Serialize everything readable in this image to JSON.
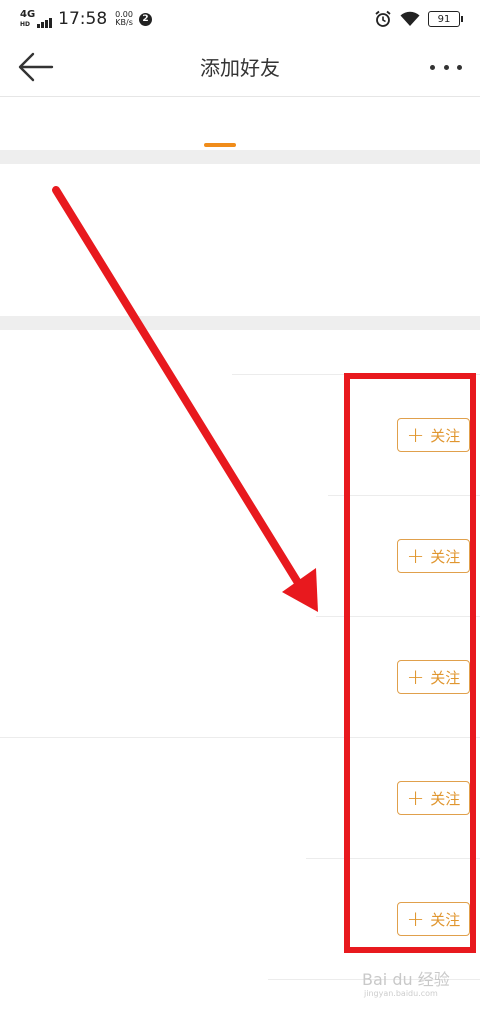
{
  "status_bar": {
    "network": "4G",
    "hd": "HD",
    "time": "17:58",
    "speed_value": "0.00",
    "speed_unit": "KB/s",
    "notification_count": "2",
    "battery": "91"
  },
  "header": {
    "title": "添加好友",
    "back_icon": "arrow-left-icon",
    "more_icon": "more-horizontal-icon"
  },
  "follow_buttons": [
    {
      "plus": "+",
      "label": "关注"
    },
    {
      "plus": "+",
      "label": "关注"
    },
    {
      "plus": "+",
      "label": "关注"
    },
    {
      "plus": "+",
      "label": "关注"
    },
    {
      "plus": "+",
      "label": "关注"
    }
  ],
  "watermark": {
    "brand": "Bai du 经验",
    "url": "jingyan.baidu.com"
  },
  "colors": {
    "accent": "#f08c1a",
    "follow_text": "#e0962f",
    "annotation_red": "#e8191e"
  }
}
